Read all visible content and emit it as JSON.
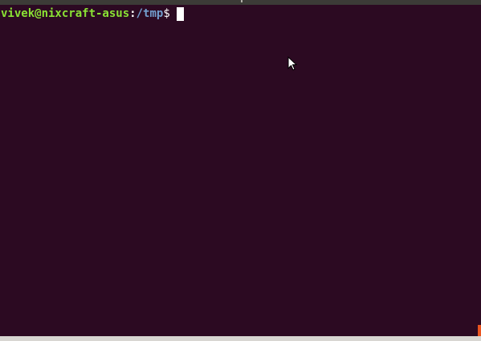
{
  "terminal": {
    "user_host": "vivek@nixcraft-asus",
    "colon": ":",
    "cwd": "/tmp",
    "prompt_symbol": "$",
    "background_color": "#2c0a22",
    "user_host_color": "#8ae234",
    "cwd_color": "#729fcf"
  },
  "icons": {
    "mouse_pointer": "arrow-pointer-icon"
  },
  "scrollbar": {
    "accent_color": "#e95420"
  }
}
